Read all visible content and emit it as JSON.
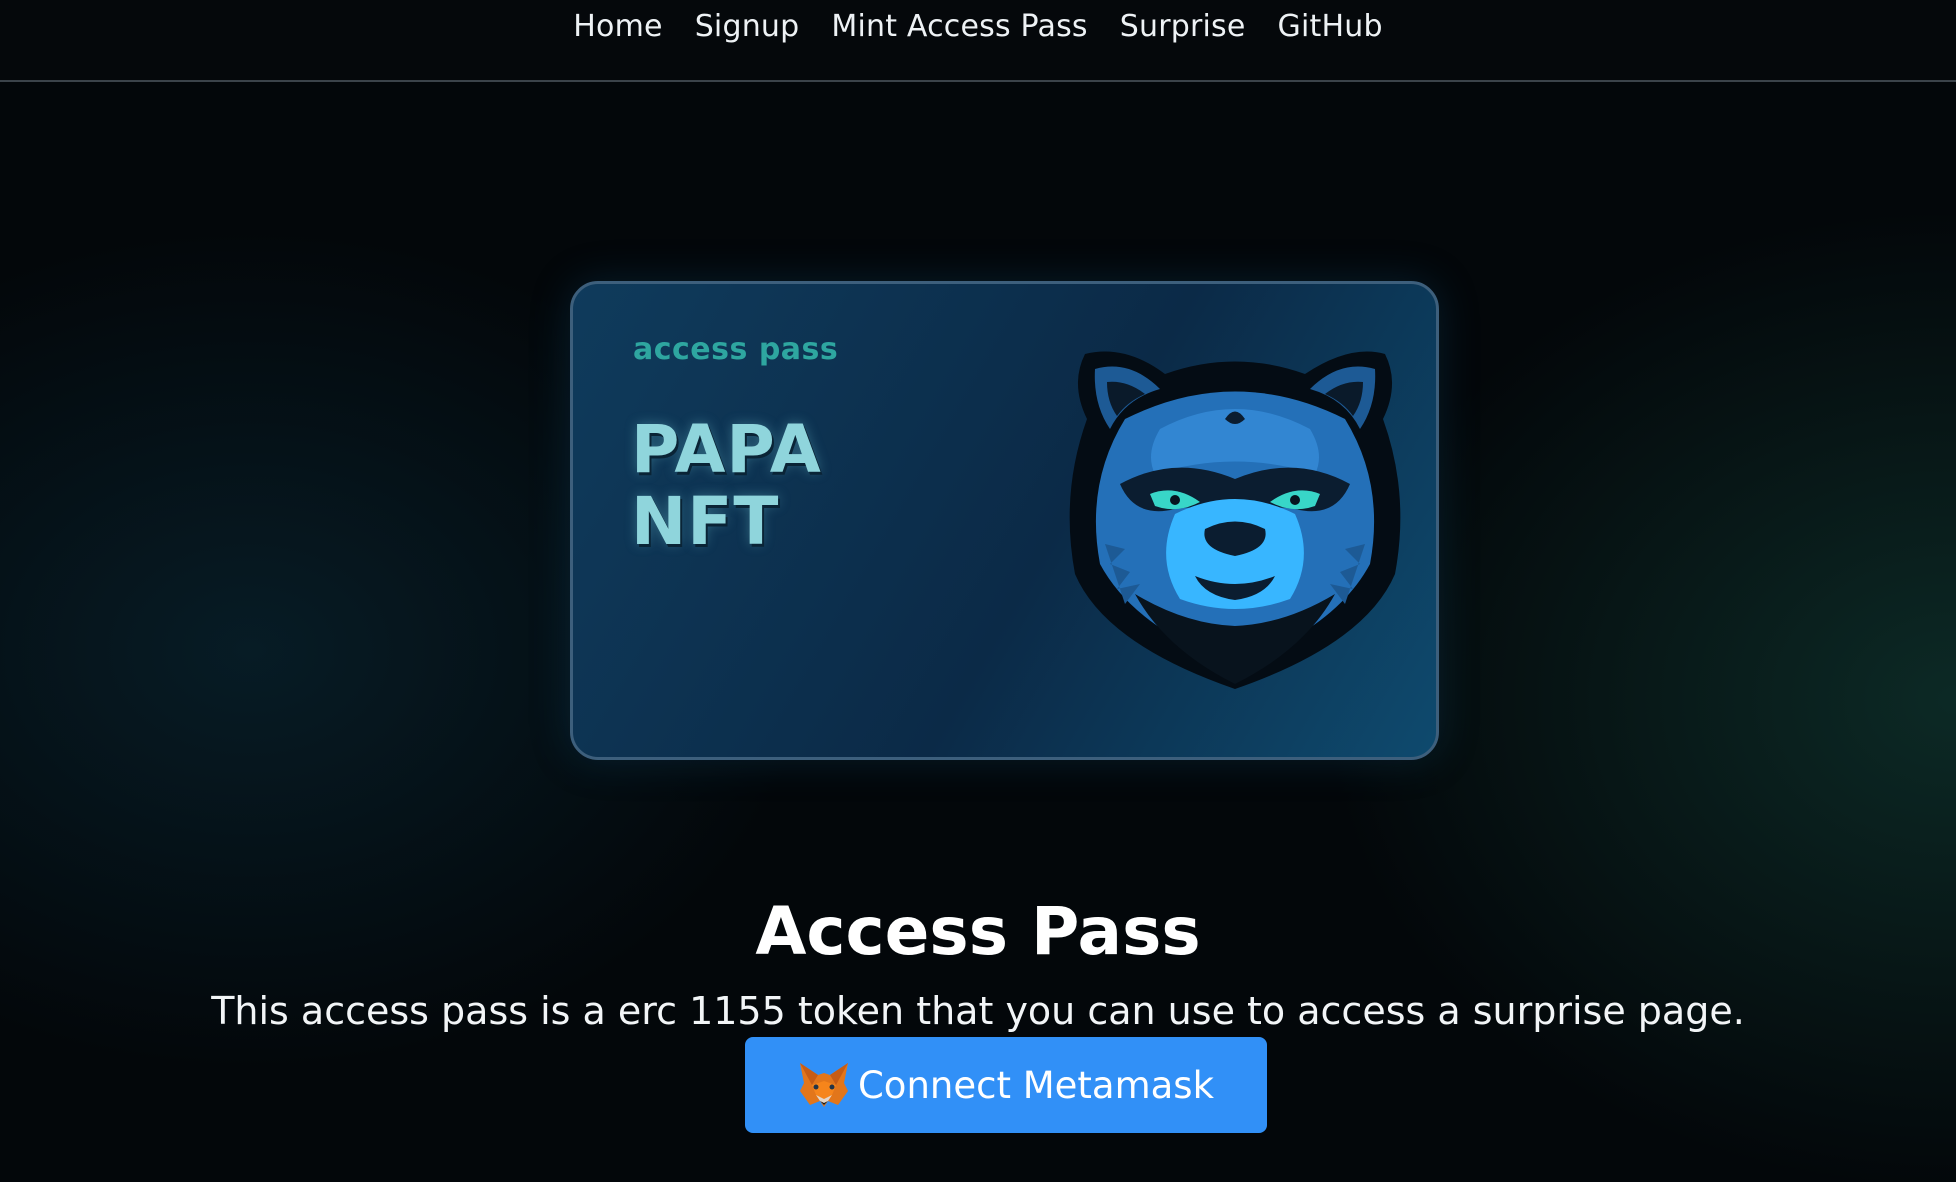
{
  "nav": {
    "items": [
      {
        "label": "Home"
      },
      {
        "label": "Signup"
      },
      {
        "label": "Mint Access Pass"
      },
      {
        "label": "Surprise"
      },
      {
        "label": "GitHub"
      }
    ]
  },
  "card": {
    "subtitle": "access pass",
    "title_line1": "PAPA",
    "title_line2": "NFT",
    "mascot_icon": "bear-head-icon"
  },
  "main": {
    "heading": "Access Pass",
    "description": "This access pass is a erc 1155 token that you can use to access a surprise page."
  },
  "connect_button": {
    "label": "Connect Metamask",
    "icon": "metamask-fox-icon",
    "color": "#3190f7"
  },
  "colors": {
    "background": "#03070a",
    "card_accent": "#2ea6a0",
    "card_title": "#8fd5dc"
  }
}
